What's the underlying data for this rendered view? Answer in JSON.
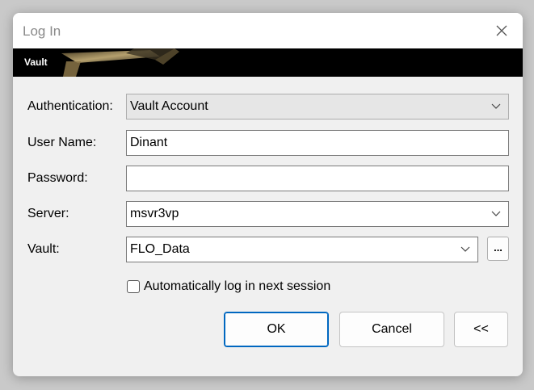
{
  "window": {
    "title": "Log In"
  },
  "banner": {
    "label": "Vault"
  },
  "form": {
    "authentication": {
      "label": "Authentication:",
      "value": "Vault Account"
    },
    "username": {
      "label": "User Name:",
      "value": "Dinant"
    },
    "password": {
      "label": "Password:",
      "value": ""
    },
    "server": {
      "label": "Server:",
      "value": "msvr3vp"
    },
    "vault": {
      "label": "Vault:",
      "value": "FLO_Data",
      "browse_label": "..."
    },
    "auto_login": {
      "label": "Automatically log in next session",
      "checked": false
    }
  },
  "buttons": {
    "ok": "OK",
    "cancel": "Cancel",
    "collapse": "<<"
  },
  "colors": {
    "accent": "#0067c0",
    "banner_bg": "#000000"
  }
}
